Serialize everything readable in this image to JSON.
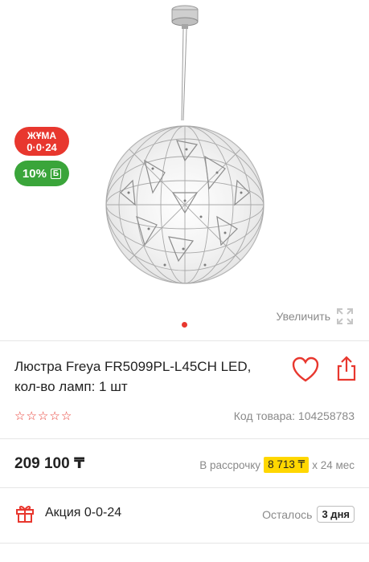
{
  "gallery": {
    "promo_badge_line1": "ЖҰМА",
    "promo_badge_line2": "0·0·24",
    "bonus_badge_text": "10%",
    "bonus_badge_symbol": "Б",
    "zoom_label": "Увеличить",
    "zoom_icon": "expand-icon",
    "pager_active_color": "#e8372e"
  },
  "product": {
    "title": "Люстра Freya FR5099PL-L45CH LED, кол-во ламп: 1 шт",
    "rating_stars": 0,
    "rating_max": 5,
    "code_text": "Код товара: 104258783"
  },
  "pricing": {
    "price": "209 100 ₸",
    "installment_prefix": "В рассрочку",
    "installment_amount": "8 713 ₸",
    "installment_suffix": "x 24 мес"
  },
  "promo": {
    "label": "Акция 0-0-24",
    "remaining_label": "Осталось",
    "remaining_days": "3 дня"
  },
  "colors": {
    "accent": "#e8372e",
    "bonus": "#3aa53a",
    "highlight": "#ffd700"
  }
}
